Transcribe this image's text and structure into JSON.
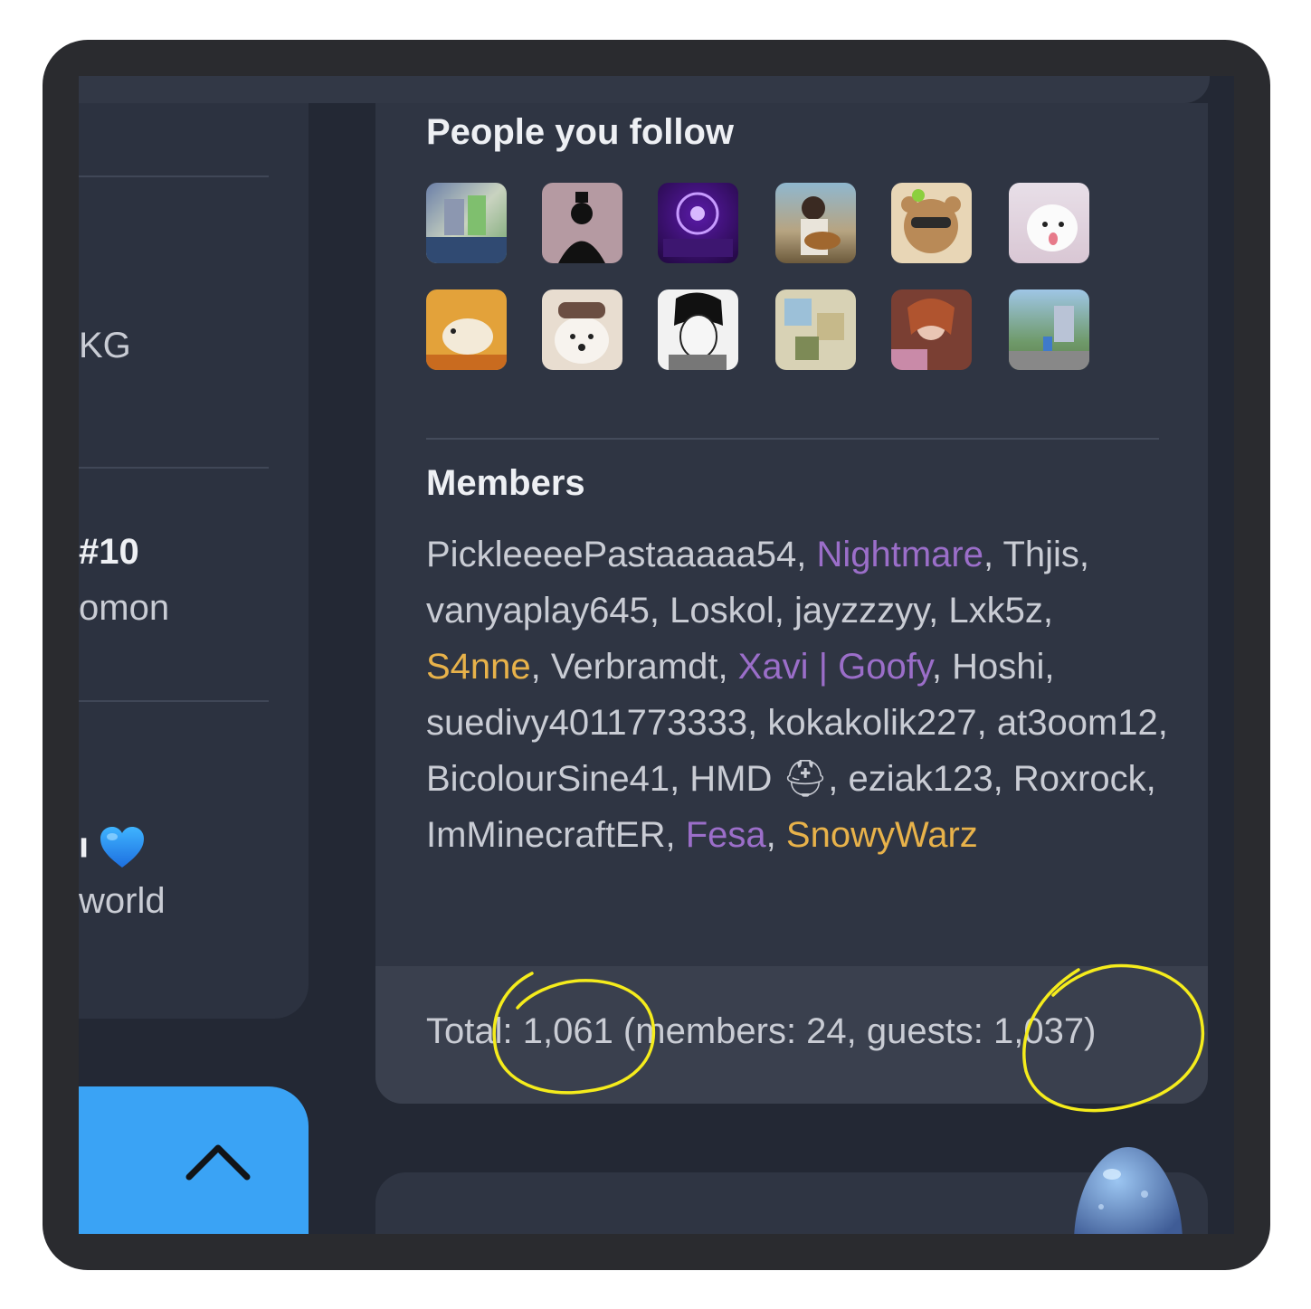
{
  "sidebar": {
    "item1_text": "KG",
    "item2_title": "#10",
    "item2_sub": "omon",
    "item3_title": "ı",
    "item3_sub": "world"
  },
  "people_follow": {
    "title": "People you follow",
    "avatars": [
      {
        "icon": "avatar-icon"
      },
      {
        "icon": "avatar-icon"
      },
      {
        "icon": "avatar-icon"
      },
      {
        "icon": "avatar-icon"
      },
      {
        "icon": "avatar-icon"
      },
      {
        "icon": "avatar-icon"
      },
      {
        "icon": "avatar-icon"
      },
      {
        "icon": "avatar-icon"
      },
      {
        "icon": "avatar-icon"
      },
      {
        "icon": "avatar-icon"
      },
      {
        "icon": "avatar-icon"
      },
      {
        "icon": "avatar-icon"
      }
    ]
  },
  "members": {
    "title": "Members",
    "list": [
      {
        "name": "PickleeeePastaaaaa54",
        "color": "default"
      },
      {
        "name": "Nightmare",
        "color": "purple"
      },
      {
        "name": "Thjis",
        "color": "default"
      },
      {
        "name": "vanyaplay645",
        "color": "default"
      },
      {
        "name": "Loskol",
        "color": "default"
      },
      {
        "name": "jayzzzyy",
        "color": "default"
      },
      {
        "name": "Lxk5z",
        "color": "default"
      },
      {
        "name": "S4nne",
        "color": "orange"
      },
      {
        "name": "Verbramdt",
        "color": "default"
      },
      {
        "name": "Xavi | Goofy",
        "color": "purple"
      },
      {
        "name": "Hoshi",
        "color": "default"
      },
      {
        "name": "suedivy4011773333",
        "color": "default"
      },
      {
        "name": "kokakolik227",
        "color": "default"
      },
      {
        "name": "at3oom12",
        "color": "default"
      },
      {
        "name": "BicolourSine41",
        "color": "default"
      },
      {
        "name": "HMD ⛑",
        "color": "default"
      },
      {
        "name": "eziak123",
        "color": "default"
      },
      {
        "name": "Roxrock",
        "color": "default"
      },
      {
        "name": "ImMinecraftER",
        "color": "default"
      },
      {
        "name": "Fesa",
        "color": "purple"
      },
      {
        "name": "SnowyWarz",
        "color": "orange"
      }
    ],
    "separator": ", "
  },
  "footer": {
    "text": "Total: 1,061 (members: 24, guests: 1,037)"
  },
  "colors": {
    "purple": "#9b6ec9",
    "orange": "#e8b24a",
    "accent_blue": "#3aa3f5",
    "annotation_yellow": "#f5ec1c"
  }
}
